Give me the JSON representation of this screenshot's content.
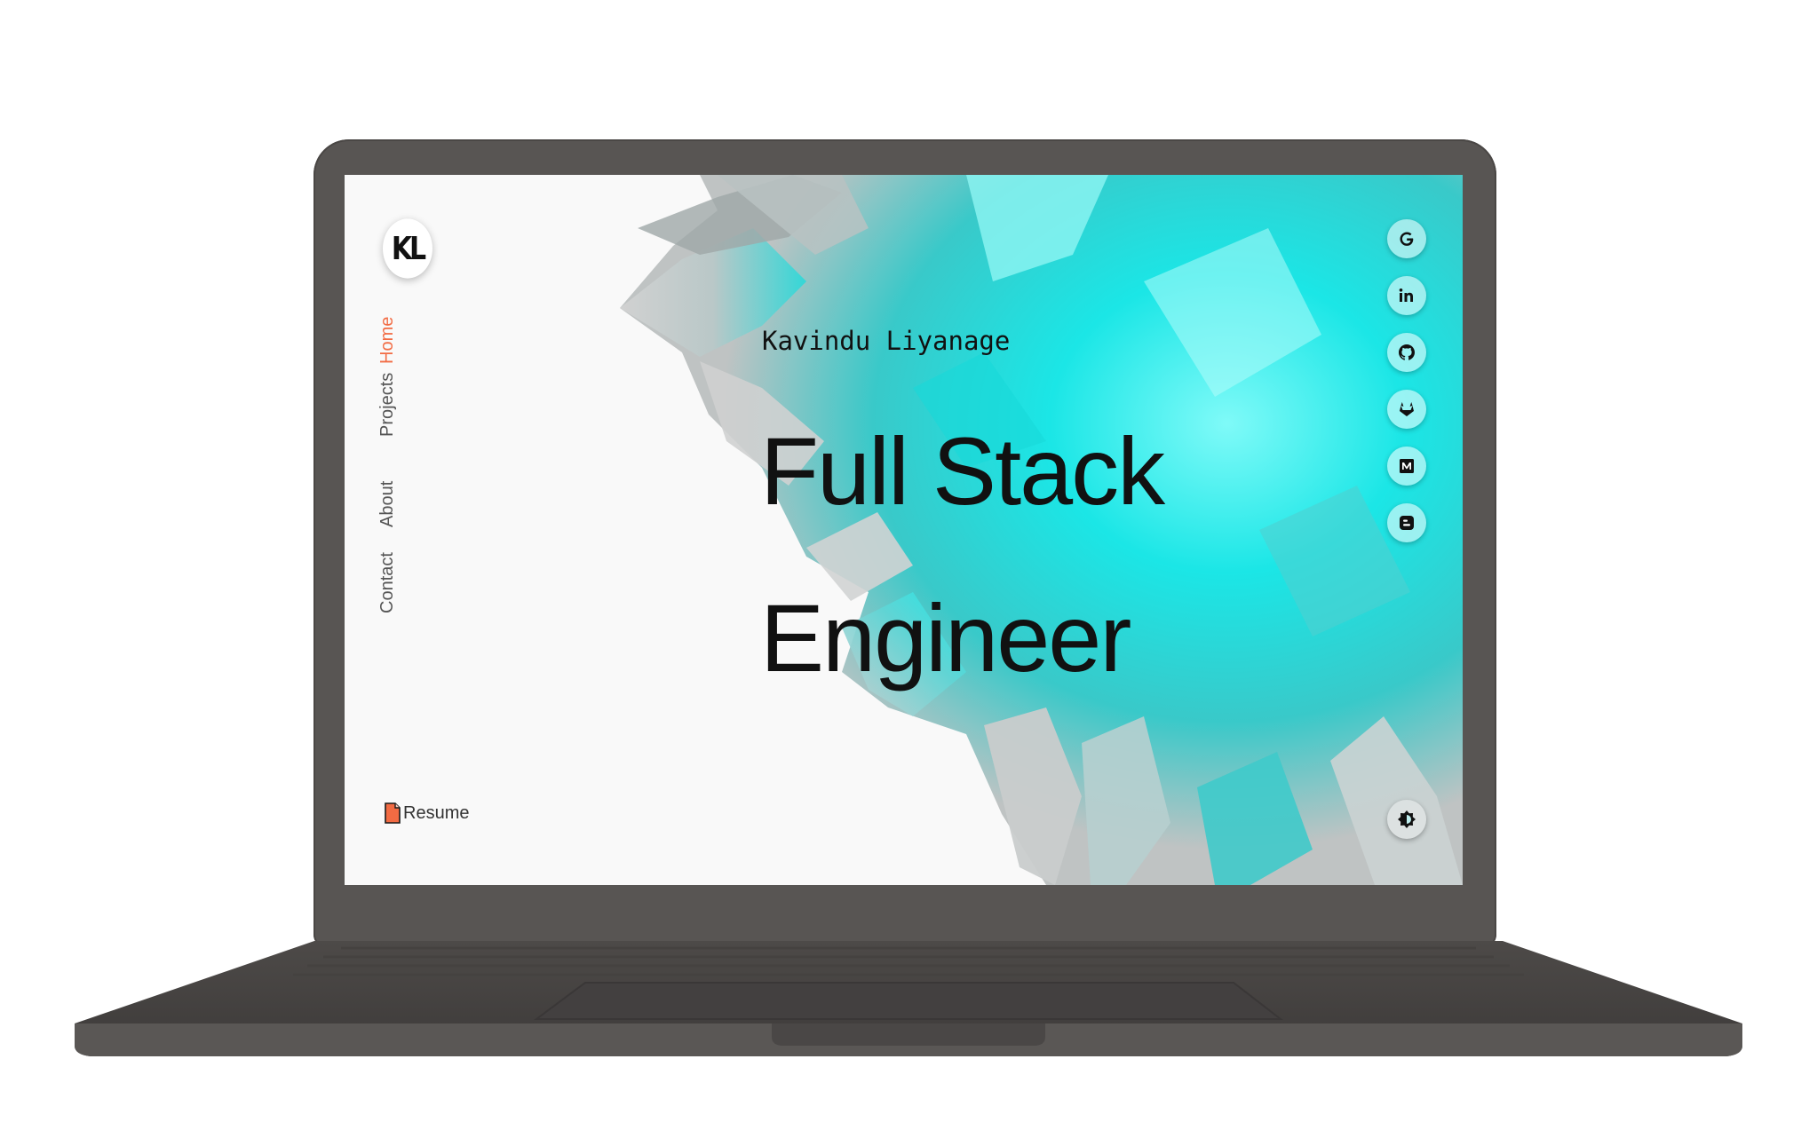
{
  "logo": {
    "text": "KL"
  },
  "nav": {
    "items": [
      {
        "label": "Home",
        "active": true
      },
      {
        "label": "Projects",
        "active": false
      },
      {
        "label": "About",
        "active": false
      },
      {
        "label": "Contact",
        "active": false
      }
    ]
  },
  "hero": {
    "name": "Kavindu Liyanage",
    "title_line1": "Full Stack",
    "title_line2": "Engineer"
  },
  "resume": {
    "label": "Resume",
    "icon": "file-icon"
  },
  "social": [
    {
      "name": "google-icon",
      "glyph": "G"
    },
    {
      "name": "linkedin-icon",
      "glyph": "in"
    },
    {
      "name": "github-icon",
      "glyph": "github"
    },
    {
      "name": "gitlab-icon",
      "glyph": "gitlab"
    },
    {
      "name": "medium-icon",
      "glyph": "M"
    },
    {
      "name": "blogger-icon",
      "glyph": "B"
    }
  ],
  "theme_toggle": {
    "icon": "brightness-icon"
  },
  "colors": {
    "accent": "#f26b43",
    "text": "#111111",
    "cyan": "#14e0e0",
    "laptop": "#585553",
    "screen_bg": "#f9f9f9"
  }
}
